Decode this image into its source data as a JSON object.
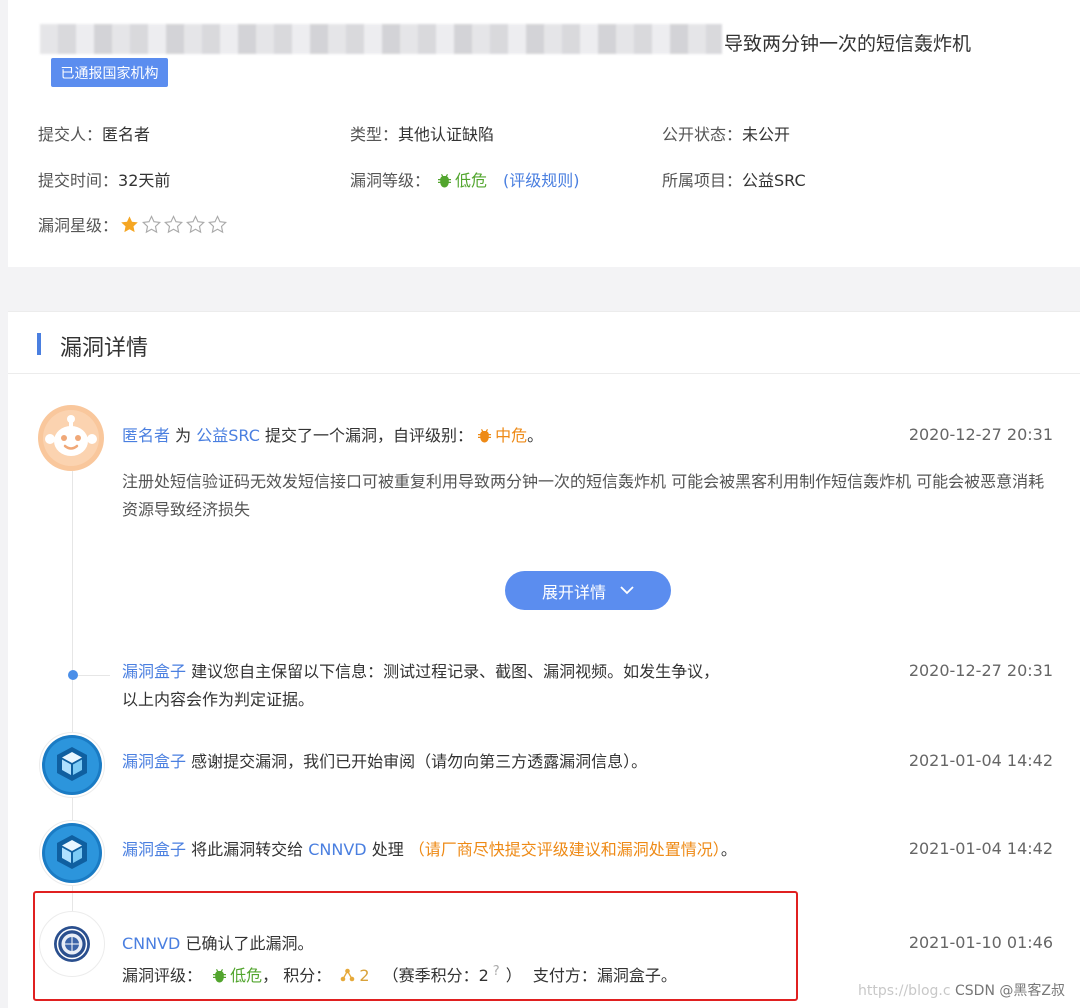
{
  "header": {
    "title_visible": "导致两分钟一次的短信轰炸机",
    "badge": "已通报国家机构"
  },
  "meta": {
    "submitter_label": "提交人：",
    "submitter": "匿名者",
    "type_label": "类型：",
    "type": "其他认证缺陷",
    "public_label": "公开状态：",
    "public": "未公开",
    "time_label": "提交时间：",
    "time": "32天前",
    "level_label": "漏洞等级：",
    "level": "低危",
    "level_rule": "(评级规则)",
    "project_label": "所属项目：",
    "project": "公益SRC",
    "stars_label": "漏洞星级：",
    "stars_value": 1,
    "stars_max": 5
  },
  "details": {
    "section_title": "漏洞详情",
    "expand_label": "展开详情",
    "entries": [
      {
        "actor": "匿名者",
        "text1": "为",
        "target": "公益SRC",
        "text2": "提交了一个漏洞，自评级别：",
        "rating": "中危",
        "end": "。",
        "time": "2020-12-27 20:31",
        "description": "注册处短信验证码无效发短信接口可被重复利用导致两分钟一次的短信轰炸机 可能会被黑客利用制作短信轰炸机 可能会被恶意消耗资源导致经济损失"
      },
      {
        "actor": "漏洞盒子",
        "line1": "建议您自主保留以下信息：测试过程记录、截图、漏洞视频。如发生争议，",
        "line2": "以上内容会作为判定证据。",
        "time": "2020-12-27 20:31"
      },
      {
        "actor": "漏洞盒子",
        "text": "感谢提交漏洞，我们已开始审阅（请勿向第三方透露漏洞信息）。",
        "time": "2021-01-04 14:42"
      },
      {
        "actor": "漏洞盒子",
        "text1": "将此漏洞转交给",
        "target": "CNNVD",
        "text2": "处理",
        "note": "（请厂商尽快提交评级建议和漏洞处置情况）",
        "end": "。",
        "time": "2021-01-04 14:42"
      },
      {
        "actor": "CNNVD",
        "text": "已确认了此漏洞。",
        "rating_label": "漏洞评级：",
        "rating": "低危",
        "score_label": "，  积分：",
        "score": "2",
        "season_label": "（赛季积分：",
        "season_score": "2",
        "help": "?",
        "season_end": "）",
        "payer_label": "支付方：",
        "payer": "漏洞盒子。",
        "time": "2021-01-10 01:46"
      }
    ]
  },
  "watermark": {
    "faint": "https://blog.c",
    "text": "CSDN @黑客Z叔"
  },
  "colors": {
    "accent": "#5b8def",
    "link": "#4a7fe0",
    "low": "#52a52e",
    "mid": "#ee8a16",
    "highlight": "#e02020",
    "star": "#f5a623"
  },
  "icons": [
    "bug-icon",
    "star-icon",
    "chevron-down-icon",
    "cube-icon",
    "emblem-icon",
    "mascot-icon",
    "score-icon",
    "help-icon"
  ]
}
